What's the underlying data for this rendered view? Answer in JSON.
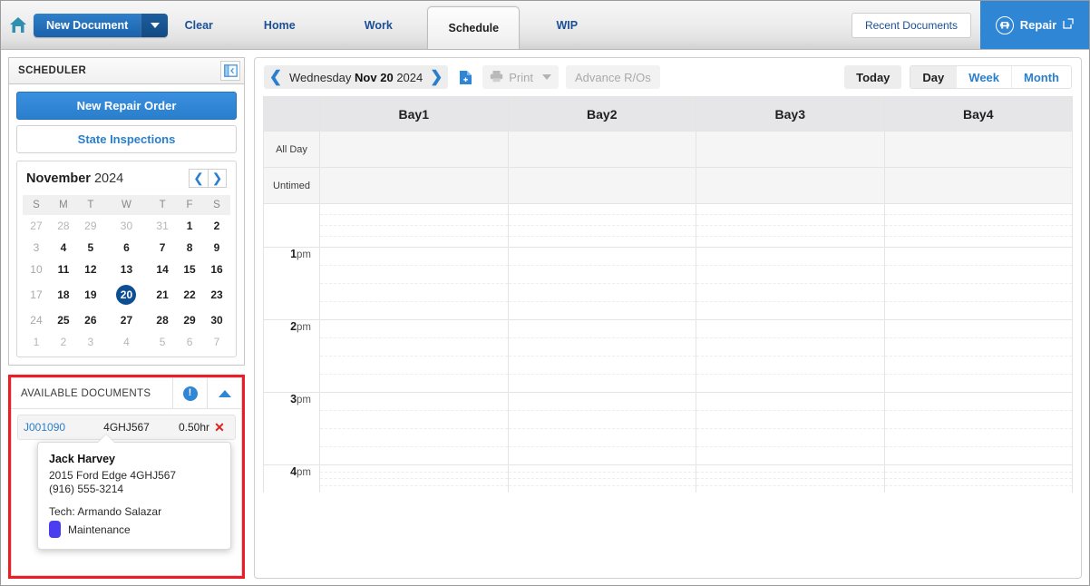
{
  "topnav": {
    "home_icon": "home-icon",
    "new_document": "New Document",
    "links": [
      {
        "label": "Clear",
        "key": "clear"
      },
      {
        "label": "Home",
        "key": "home"
      },
      {
        "label": "Work",
        "key": "work"
      }
    ],
    "active_tab": "Schedule",
    "wip": "WIP",
    "recent_documents": "Recent Documents",
    "repair": "Repair",
    "repair_icon": "vehicle-repair-icon",
    "external_link_icon": "external-link-icon",
    "accent_blue": "#2e86d4",
    "button_blue": "#1b62ab"
  },
  "sidebar": {
    "title": "SCHEDULER",
    "collapse_icon": "collapse-panel-icon",
    "new_repair_order": "New Repair Order",
    "state_inspections": "State Inspections",
    "calendar": {
      "month": "November",
      "year": "2024",
      "prev_icon": "chevron-left-icon",
      "next_icon": "chevron-right-icon",
      "weekdays": [
        "S",
        "M",
        "T",
        "W",
        "T",
        "F",
        "S"
      ],
      "weeks": [
        [
          {
            "d": "27",
            "cls": "muted"
          },
          {
            "d": "28",
            "cls": "muted"
          },
          {
            "d": "29",
            "cls": "muted"
          },
          {
            "d": "30",
            "cls": "muted"
          },
          {
            "d": "31",
            "cls": "muted"
          },
          {
            "d": "1",
            "cls": ""
          },
          {
            "d": "2",
            "cls": ""
          }
        ],
        [
          {
            "d": "3",
            "cls": "sun"
          },
          {
            "d": "4",
            "cls": ""
          },
          {
            "d": "5",
            "cls": ""
          },
          {
            "d": "6",
            "cls": ""
          },
          {
            "d": "7",
            "cls": ""
          },
          {
            "d": "8",
            "cls": ""
          },
          {
            "d": "9",
            "cls": ""
          }
        ],
        [
          {
            "d": "10",
            "cls": "sun"
          },
          {
            "d": "11",
            "cls": ""
          },
          {
            "d": "12",
            "cls": ""
          },
          {
            "d": "13",
            "cls": ""
          },
          {
            "d": "14",
            "cls": ""
          },
          {
            "d": "15",
            "cls": ""
          },
          {
            "d": "16",
            "cls": ""
          }
        ],
        [
          {
            "d": "17",
            "cls": "sun"
          },
          {
            "d": "18",
            "cls": ""
          },
          {
            "d": "19",
            "cls": ""
          },
          {
            "d": "20",
            "cls": "sel"
          },
          {
            "d": "21",
            "cls": ""
          },
          {
            "d": "22",
            "cls": ""
          },
          {
            "d": "23",
            "cls": ""
          }
        ],
        [
          {
            "d": "24",
            "cls": "sun"
          },
          {
            "d": "25",
            "cls": ""
          },
          {
            "d": "26",
            "cls": ""
          },
          {
            "d": "27",
            "cls": ""
          },
          {
            "d": "28",
            "cls": ""
          },
          {
            "d": "29",
            "cls": ""
          },
          {
            "d": "30",
            "cls": ""
          }
        ],
        [
          {
            "d": "1",
            "cls": "muted"
          },
          {
            "d": "2",
            "cls": "muted"
          },
          {
            "d": "3",
            "cls": "muted"
          },
          {
            "d": "4",
            "cls": "muted"
          },
          {
            "d": "5",
            "cls": "muted"
          },
          {
            "d": "6",
            "cls": "muted"
          },
          {
            "d": "7",
            "cls": "muted"
          }
        ]
      ],
      "selected_day": "20"
    },
    "available_documents": {
      "title": "AVAILABLE DOCUMENTS",
      "alert_icon": "alert-info-icon",
      "alert_glyph": "!",
      "collapse_icon": "chevron-up-icon",
      "rows": [
        {
          "id": "J001090",
          "plate": "4GHJ567",
          "hours": "0.50hr",
          "remove_icon": "close-icon",
          "remove_glyph": "✕"
        }
      ],
      "tooltip": {
        "name": "Jack Harvey",
        "vehicle": "2015 Ford Edge 4GHJ567",
        "phone": "(916) 555-3214",
        "tech": "Tech: Armando Salazar",
        "status_label": "Maintenance",
        "status_color": "#4b3ef0"
      }
    }
  },
  "main": {
    "toolbar": {
      "prev_icon": "chevron-left-icon",
      "next_icon": "chevron-right-icon",
      "date_weekday": "Wednesday",
      "date_monthday": "Nov 20",
      "date_year": "2024",
      "document_icon": "add-document-icon",
      "print_label": "Print",
      "print_icon": "printer-icon",
      "print_caret_icon": "chevron-down-icon",
      "advance_ros": "Advance R/Os",
      "today": "Today",
      "views": [
        {
          "label": "Day",
          "active": true
        },
        {
          "label": "Week",
          "active": false
        },
        {
          "label": "Month",
          "active": false
        }
      ]
    },
    "schedule": {
      "columns": [
        "Bay1",
        "Bay2",
        "Bay3",
        "Bay4"
      ],
      "special_rows": [
        "All Day",
        "Untimed"
      ],
      "hours": [
        {
          "num": "",
          "suffix": "",
          "type": "lead"
        },
        {
          "num": "1",
          "suffix": "pm",
          "type": "hour"
        },
        {
          "num": "2",
          "suffix": "pm",
          "type": "hour"
        },
        {
          "num": "3",
          "suffix": "pm",
          "type": "hour"
        },
        {
          "num": "4",
          "suffix": "pm",
          "type": "tail"
        }
      ],
      "events": []
    }
  }
}
